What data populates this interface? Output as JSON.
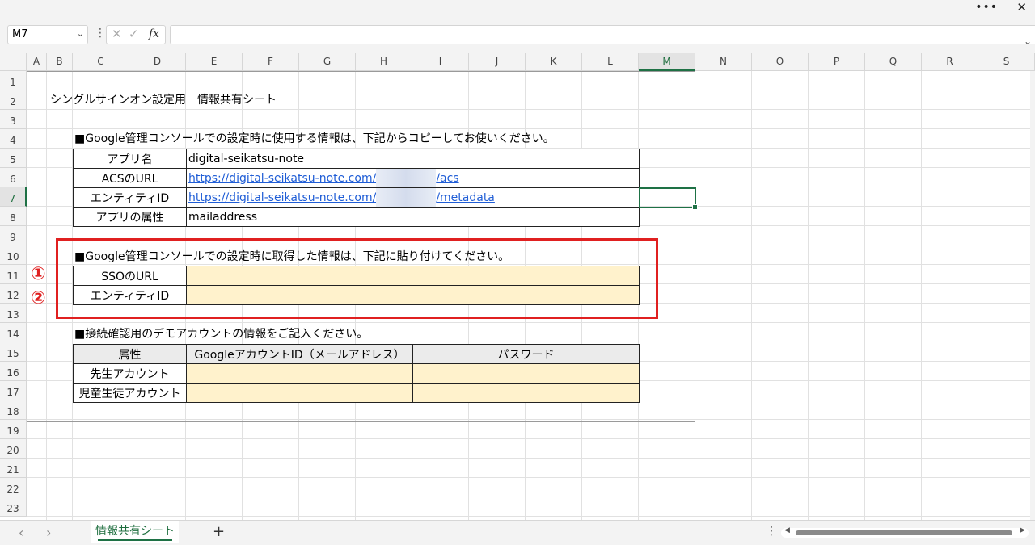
{
  "window": {
    "more_icon": "more-horizontal-icon",
    "close_icon": "close-icon"
  },
  "formula_bar": {
    "name_box": "M7",
    "formula": ""
  },
  "columns": [
    "A",
    "B",
    "C",
    "D",
    "E",
    "F",
    "G",
    "H",
    "I",
    "J",
    "K",
    "L",
    "M",
    "N",
    "O",
    "P",
    "Q",
    "R",
    "S"
  ],
  "rows": [
    "1",
    "2",
    "3",
    "4",
    "5",
    "6",
    "7",
    "8",
    "9",
    "10",
    "11",
    "12",
    "13",
    "14",
    "15",
    "16",
    "17",
    "18",
    "19",
    "20",
    "21",
    "22",
    "23"
  ],
  "selected": {
    "column": "M",
    "row": "7"
  },
  "sheet": {
    "title": "シングルサインオン設定用　情報共有シート",
    "section1_heading": "■Google管理コンソールでの設定時に使用する情報は、下記からコピーしてお使いください。",
    "table1": [
      {
        "label": "アプリ名",
        "value": "digital-seikatsu-note"
      },
      {
        "label": "ACSのURL",
        "value_prefix": "https://digital-seikatsu-note.com/",
        "value_suffix": "/acs"
      },
      {
        "label": "エンティティID",
        "value_prefix": "https://digital-seikatsu-note.com/",
        "value_suffix": "/metadata"
      },
      {
        "label": "アプリの属性",
        "value": "mailaddress"
      }
    ],
    "section2_heading": "■Google管理コンソールでの設定時に取得した情報は、下記に貼り付けてください。",
    "table2": [
      {
        "marker": "①",
        "label": "SSOのURL",
        "value": ""
      },
      {
        "marker": "②",
        "label": "エンティティID",
        "value": ""
      }
    ],
    "section3_heading": "■接続確認用のデモアカウントの情報をご記入ください。",
    "table3": {
      "headers": [
        "属性",
        "GoogleアカウントID（メールアドレス）",
        "パスワード"
      ],
      "rows": [
        {
          "label": "先生アカウント",
          "id": "",
          "password": ""
        },
        {
          "label": "児童生徒アカウント",
          "id": "",
          "password": ""
        }
      ]
    }
  },
  "status_bar": {
    "sheet_tab": "情報共有シート",
    "add_sheet": "+"
  },
  "colors": {
    "accent_green": "#1e7145",
    "input_fill": "#fff2cc",
    "highlight_red": "#e02020",
    "link_blue": "#1f5dd6"
  }
}
